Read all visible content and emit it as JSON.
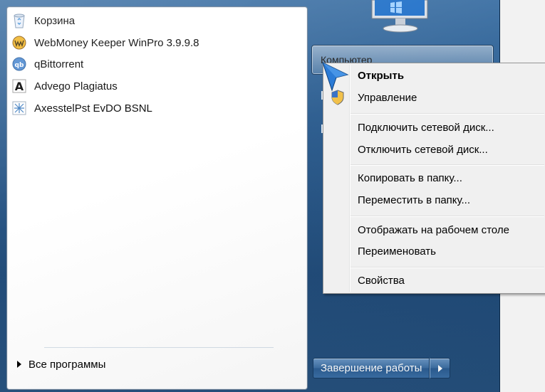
{
  "left_panel": {
    "programs": [
      {
        "label": "Корзина",
        "icon": "recycle-bin-icon"
      },
      {
        "label": "WebMoney Keeper WinPro 3.9.9.8",
        "icon": "webmoney-icon"
      },
      {
        "label": "qBittorrent",
        "icon": "qbittorrent-icon"
      },
      {
        "label": "Advego Plagiatus",
        "icon": "advego-icon"
      },
      {
        "label": "AxesstelPst EvDO BSNL",
        "icon": "axesstel-icon"
      }
    ],
    "all_programs_label": "Все программы"
  },
  "right_panel": {
    "computer_label": "Компьютер",
    "shutdown_label": "Завершение работы"
  },
  "context_menu": {
    "items": [
      {
        "label": "Открыть",
        "bold": true
      },
      {
        "label": "Управление",
        "icon": "uac-shield-icon"
      },
      {
        "label": "Подключить сетевой диск..."
      },
      {
        "label": "Отключить сетевой диск..."
      },
      {
        "label": "Копировать в папку..."
      },
      {
        "label": "Переместить в папку..."
      },
      {
        "label": "Отображать на рабочем столе"
      },
      {
        "label": "Переименовать"
      },
      {
        "label": "Свойства"
      }
    ]
  },
  "colors": {
    "menu_blue": "#2a5a8c",
    "context_bg": "#f0f0f0",
    "panel_white": "#ffffff"
  }
}
